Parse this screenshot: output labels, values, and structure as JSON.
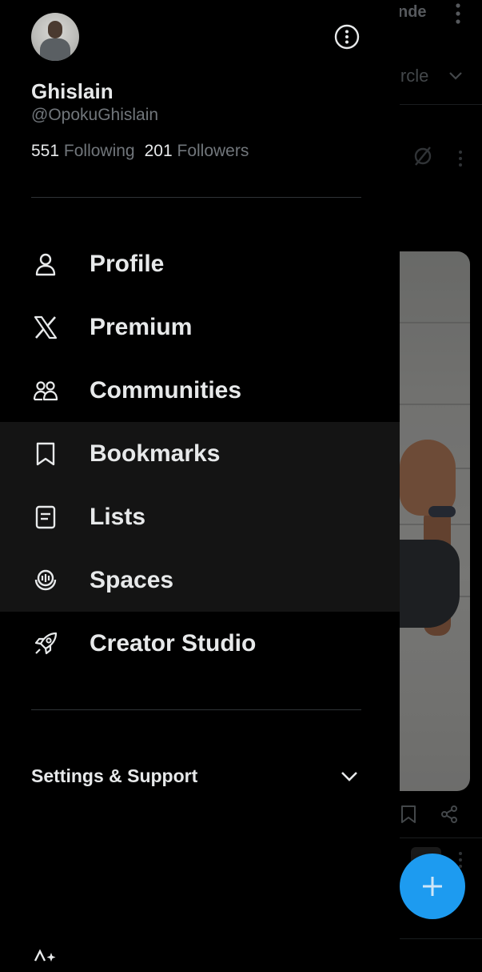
{
  "background": {
    "top_text": "nde",
    "tab_label": "ircle",
    "fab_color": "#1d9bf0",
    "icons": [
      "kebab-icon",
      "chevron-down-icon",
      "no-sign-icon",
      "bookmark-icon",
      "share-icon",
      "plus-icon"
    ]
  },
  "profile": {
    "display_name": "Ghislain",
    "handle": "@OpokuGhislain",
    "following_count": "551",
    "following_label": "Following",
    "followers_count": "201",
    "followers_label": "Followers"
  },
  "menu": {
    "items": [
      {
        "label": "Profile",
        "icon": "person-icon"
      },
      {
        "label": "Premium",
        "icon": "x-logo-icon"
      },
      {
        "label": "Communities",
        "icon": "communities-icon"
      },
      {
        "label": "Bookmarks",
        "icon": "bookmark-icon"
      },
      {
        "label": "Lists",
        "icon": "list-icon"
      },
      {
        "label": "Spaces",
        "icon": "spaces-icon"
      },
      {
        "label": "Creator Studio",
        "icon": "rocket-icon"
      }
    ]
  },
  "settings": {
    "label": "Settings & Support"
  },
  "colors": {
    "background": "#000000",
    "text_primary": "#e7e9ea",
    "text_secondary": "#71767b",
    "highlight": "#141414",
    "accent": "#1d9bf0"
  }
}
